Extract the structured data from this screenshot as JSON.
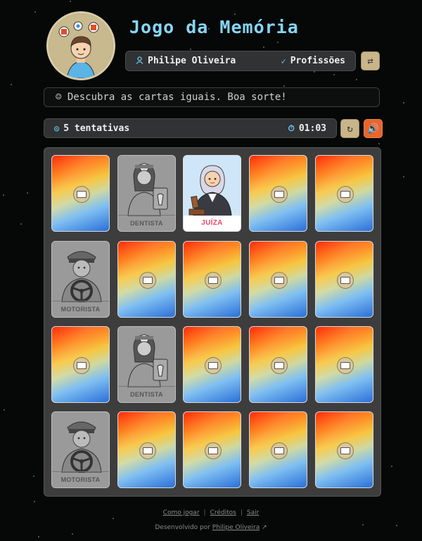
{
  "header": {
    "title": "Jogo da Memória",
    "player_name": "Philipe Oliveira",
    "theme_name": "Profissões"
  },
  "message": "☺ Descubra as cartas iguais. Boa sorte!",
  "stats": {
    "attempts": "5 tentativas",
    "timer": "01:03"
  },
  "cards": [
    {
      "state": "back"
    },
    {
      "state": "matched",
      "label": "DENTISTA",
      "icon": "dentist-icon"
    },
    {
      "state": "front",
      "label": "JUÍZA",
      "icon": "judge-icon"
    },
    {
      "state": "back"
    },
    {
      "state": "back"
    },
    {
      "state": "matched",
      "label": "MOTORISTA",
      "icon": "driver-icon"
    },
    {
      "state": "back"
    },
    {
      "state": "back"
    },
    {
      "state": "back"
    },
    {
      "state": "back"
    },
    {
      "state": "back"
    },
    {
      "state": "matched",
      "label": "DENTISTA",
      "icon": "dentist-icon"
    },
    {
      "state": "back"
    },
    {
      "state": "back"
    },
    {
      "state": "back"
    },
    {
      "state": "matched",
      "label": "MOTORISTA",
      "icon": "driver-icon"
    },
    {
      "state": "back"
    },
    {
      "state": "back"
    },
    {
      "state": "back"
    },
    {
      "state": "back"
    }
  ],
  "footer": {
    "how_to_play": "Como jogar",
    "credits": "Créditos",
    "exit": "Sair",
    "developed_by": "Desenvolvido por",
    "developer": "Philipe Oliveira"
  },
  "colors": {
    "title": "#86d6f5",
    "sound_button": "#e8652d",
    "neutral_button": "#c9b58a",
    "judge_label": "#e8476a"
  }
}
